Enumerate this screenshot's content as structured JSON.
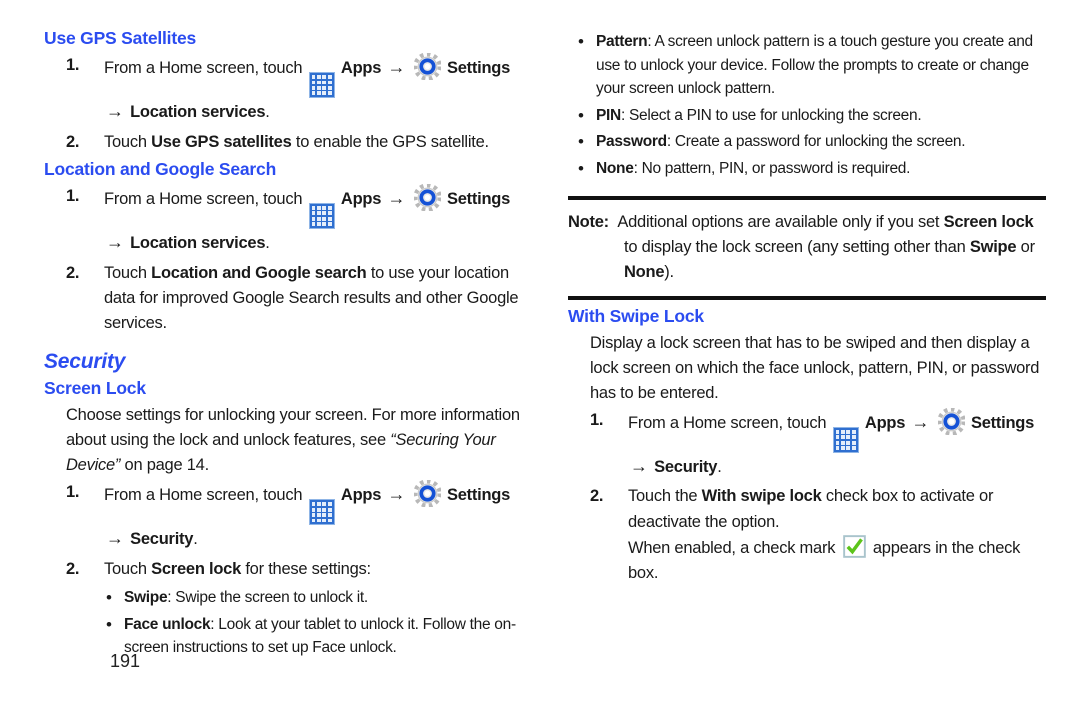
{
  "page_number": "191",
  "colors": {
    "heading_blue": "#2b4cf0",
    "apps_icon_blue": "#2f6fd0",
    "check_green": "#55c217",
    "rule_black": "#111111"
  },
  "icons": {
    "apps": "apps-grid-icon",
    "settings": "settings-gear-icon",
    "arrow": "→",
    "check": "green-check-icon"
  },
  "labels": {
    "apps": "Apps",
    "settings": "Settings"
  },
  "left_column": {
    "sections": [
      {
        "heading": "Use GPS Satellites",
        "steps": [
          {
            "num": "1.",
            "pre": "From a Home screen, touch ",
            "mid": " → ",
            "post_arrow_label": "→ ",
            "continuation_bold": "Location services",
            "continuation_tail": "."
          },
          {
            "num": "2.",
            "pre": "Touch ",
            "bold": "Use GPS satellites",
            "post": " to enable the GPS satellite."
          }
        ]
      },
      {
        "heading": "Location and Google Search",
        "steps": [
          {
            "num": "1.",
            "pre": "From a Home screen, touch ",
            "continuation_bold": "Location services",
            "continuation_tail": "."
          },
          {
            "num": "2.",
            "pre": "Touch ",
            "bold": "Location and Google search",
            "post": " to use your location data for improved Google Search results and other Google services."
          }
        ]
      }
    ],
    "security_heading": "Security",
    "screen_lock_heading": "Screen Lock",
    "screen_lock_intro_1": "Choose settings for unlocking your screen. For more information about using the lock and unlock features, see ",
    "screen_lock_intro_italic": "“Securing Your Device”",
    "screen_lock_intro_2": " on page 14.",
    "screen_lock_steps": [
      {
        "num": "1.",
        "pre": "From a Home screen, touch ",
        "continuation_bold": "Security",
        "continuation_tail": "."
      },
      {
        "num": "2.",
        "pre": "Touch ",
        "bold": "Screen lock",
        "post": " for these settings:"
      }
    ],
    "screen_lock_bullets": [
      {
        "term": "Swipe",
        "text": ": Swipe the screen to unlock it."
      },
      {
        "term": "Face unlock",
        "text": ": Look at your tablet to unlock it. Follow the on-screen instructions to set up Face unlock."
      }
    ]
  },
  "right_column": {
    "top_bullets": [
      {
        "term": "Pattern",
        "text": ": A screen unlock pattern is a touch gesture you create and use to unlock your device. Follow the prompts to create or change your screen unlock pattern."
      },
      {
        "term": "PIN",
        "text": ": Select a PIN to use for unlocking the screen."
      },
      {
        "term": "Password",
        "text": ": Create a password for unlocking the screen."
      },
      {
        "term": "None",
        "text": ": No pattern, PIN, or password is required."
      }
    ],
    "note": {
      "label": "Note:",
      "part1": " Additional options are available only if you set ",
      "bold1": "Screen lock",
      "part2": " to display the lock screen (any setting other than ",
      "bold2": "Swipe",
      "part3": " or ",
      "bold3": "None",
      "part4": ")."
    },
    "with_swipe_heading": "With Swipe Lock",
    "with_swipe_intro": "Display a lock screen that has to be swiped and then display a lock screen on which the face unlock, pattern, PIN, or password has to be entered.",
    "with_swipe_steps": [
      {
        "num": "1.",
        "pre": "From a Home screen, touch ",
        "continuation_bold": "Security",
        "continuation_tail": "."
      },
      {
        "num": "2.",
        "pre": "Touch the ",
        "bold": "With swipe lock",
        "post": " check box to activate or deactivate the option."
      }
    ],
    "check_note_pre": "When enabled, a check mark ",
    "check_note_post": " appears in the check box."
  }
}
